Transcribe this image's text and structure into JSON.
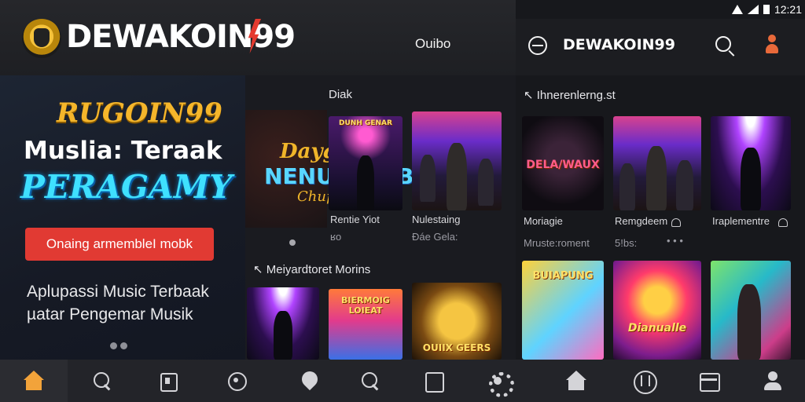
{
  "left_app": {
    "brand": "DEWAKOIN99",
    "header_link": "Ouibo",
    "hero": {
      "logo_text": "RUGOIN99",
      "headline_1": "Muslia: Teraak",
      "headline_2": "PERAGAMY",
      "cta_label": "Onaing armembleI mobk",
      "subtitle_1": "Aplupassi Music Terbaak",
      "subtitle_2": "µatar Pengemar Musik"
    },
    "feature": {
      "art_line_1": "Daygamit",
      "art_line_2": "NENU MENB",
      "art_line_3": "Chupao"
    },
    "section_top": "Diak",
    "top_items": [
      {
        "title": "Rentie Yiot",
        "sub": "ʁo",
        "art_text": "DUNH GENAR"
      },
      {
        "title": "Nulestaing",
        "sub": "Ðáe  Gela:"
      }
    ],
    "section_bottom": "Meiyardtoret Morins",
    "bottom_items": [
      {
        "art_text": ""
      },
      {
        "art_text": "BIERMOIG LOIEAT"
      },
      {
        "art_text": "OUIIX GEERS"
      }
    ]
  },
  "right_app": {
    "status_time": "12:21",
    "title": "DEWAKOIN99",
    "section_top": "Ihnerenlerng.st",
    "top_items": [
      {
        "title": "Moriagie",
        "sub": "Mruste:roment",
        "art_text": "DELA/WAUX"
      },
      {
        "title": "Remgdeem",
        "sub": "5!bs:"
      },
      {
        "title": "Iraplementre"
      }
    ],
    "more_dots": "• • •",
    "bottom_items": [
      {
        "art_text": "BUIAPUNG"
      },
      {
        "art_text": "Dianualle"
      },
      {
        "art_text": ""
      }
    ]
  },
  "bottom_nav": {
    "items": [
      {
        "icon": "home-icon",
        "active": true,
        "color": "#f2a33a"
      },
      {
        "icon": "search-icon"
      },
      {
        "icon": "library-icon"
      },
      {
        "icon": "discover-icon"
      },
      {
        "icon": "pin-icon"
      },
      {
        "icon": "search-icon"
      },
      {
        "icon": "document-icon"
      },
      {
        "icon": "gear-icon"
      },
      {
        "icon": "home-icon"
      },
      {
        "icon": "brand-mark-icon"
      },
      {
        "icon": "box-icon"
      },
      {
        "icon": "user-icon"
      }
    ]
  },
  "colors": {
    "accent_red": "#e13a33",
    "accent_cyan": "#3fe0ff",
    "accent_gold": "#f5b62b",
    "nav_active": "#f2a33a"
  }
}
